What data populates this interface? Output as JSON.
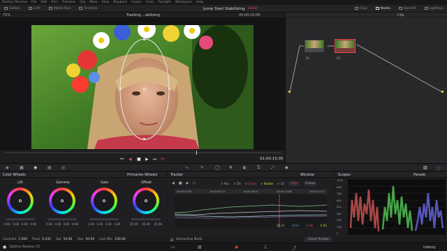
{
  "menu": [
    "DaVinci Resolve",
    "File",
    "Edit",
    "Trim",
    "Timeline",
    "Clip",
    "Mark",
    "View",
    "Playback",
    "Fusion",
    "Color",
    "Fairlight",
    "Workspace",
    "Help"
  ],
  "toolbar": {
    "left": [
      "Gallery",
      "LUTs",
      "Media Pool",
      "Timeline"
    ],
    "right": [
      "Clips",
      "Nodes",
      "OpenFX",
      "Lightbox"
    ]
  },
  "project": {
    "title": "Jump Start Stabilizing",
    "status": "Edited"
  },
  "viewer": {
    "zoom": "75%",
    "clip_name": "Tracking ...abilizing",
    "timecode_top": "00:00:10:06",
    "timecode": "01:00:15:05"
  },
  "nodes": {
    "mode": "Clip",
    "node1": "01",
    "node2": "02"
  },
  "color_wheels": {
    "title": "Color Wheels",
    "mode": "Primaries Wheels",
    "wheels": [
      {
        "label": "Lift",
        "values": [
          "0.00",
          "0.00",
          "0.00",
          "0.00"
        ]
      },
      {
        "label": "Gamma",
        "values": [
          "0.00",
          "0.00",
          "0.00",
          "0.00"
        ]
      },
      {
        "label": "Gain",
        "values": [
          "1.00",
          "1.00",
          "1.00",
          "1.00"
        ]
      },
      {
        "label": "Offset",
        "values": [
          "25.00",
          "25.00",
          "25.00"
        ]
      }
    ],
    "bottom": {
      "contrast_label": "Contrast",
      "contrast": "1.000",
      "pivot_label": "Pivot",
      "pivot": "0.435",
      "sat_label": "Sat",
      "sat": "50.00",
      "hue_label": "Hue",
      "hue": "50.00",
      "lummix_label": "Lum Mix",
      "lummix": "100.00"
    }
  },
  "tracker": {
    "title": "Tracker",
    "window_label": "Window",
    "checks": [
      "Pan",
      "Tilt",
      "Zoom",
      "Rotate",
      "3D"
    ],
    "clip_btn": "Clip",
    "frame_btn": "Frame",
    "times": [
      "00:00:00:00",
      "00:00:03:12",
      "00:00:06:24",
      "00:00:10:06",
      "00:00:13:17"
    ],
    "readouts": [
      "20.23",
      "-0.53",
      "-3.48",
      "-0.02"
    ],
    "interactive_mode": "Interactive Mode",
    "cloud_tracker": "Cloud Tracker"
  },
  "scopes": {
    "title": "Scopes",
    "mode": "Parade",
    "ticks": [
      "1023",
      "896",
      "768",
      "640",
      "512",
      "384",
      "256",
      "128",
      "0"
    ]
  },
  "status": {
    "app": "DaVinci Resolve 15",
    "brand": "Udemy"
  }
}
